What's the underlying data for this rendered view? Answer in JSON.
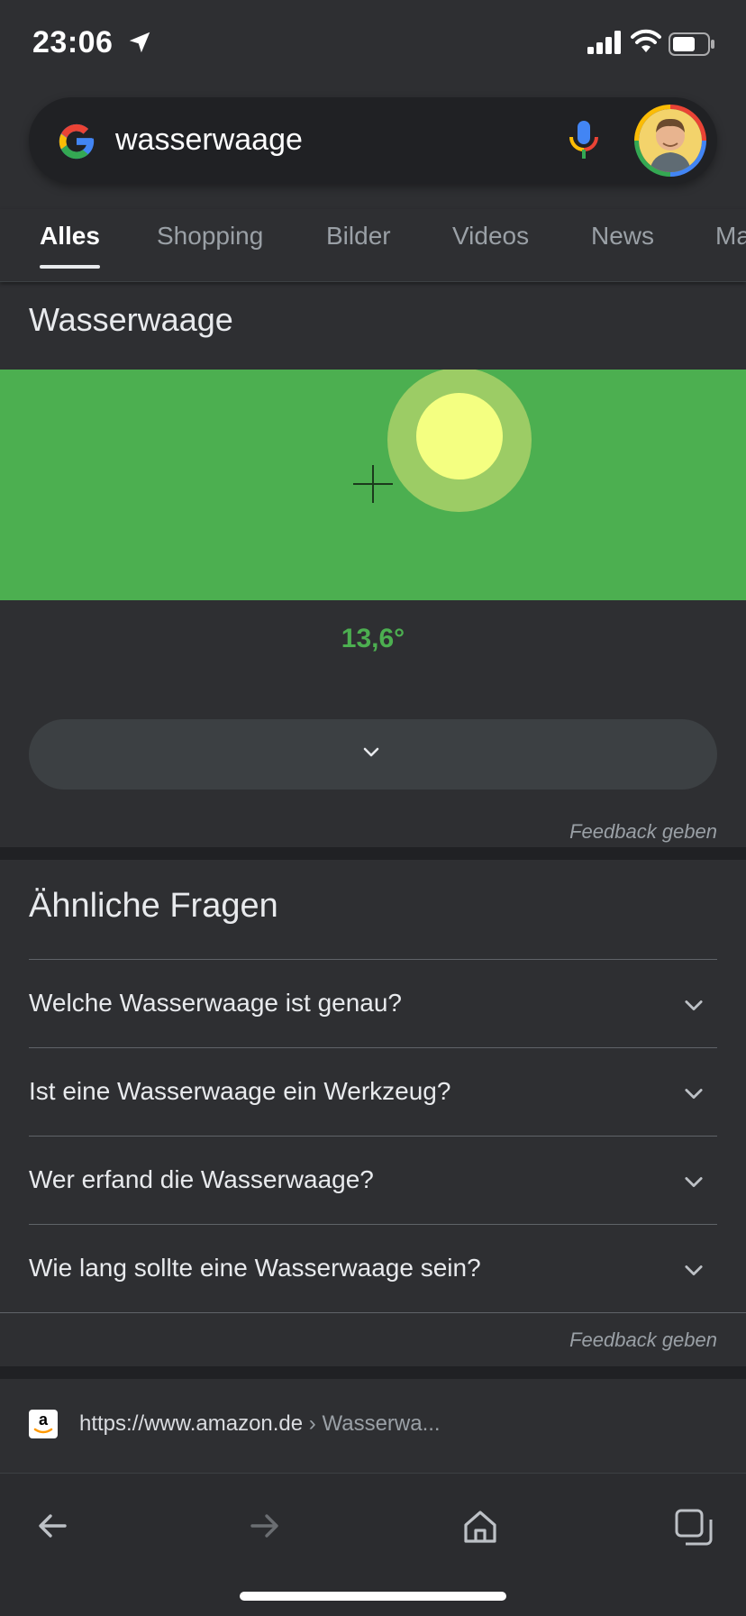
{
  "status_bar": {
    "time": "23:06",
    "icons": [
      "location-arrow-icon",
      "signal-icon",
      "wifi-icon",
      "battery-icon"
    ]
  },
  "search": {
    "query": "wasserwaage",
    "logo_icon": "google-g-icon",
    "mic_icon": "microphone-icon",
    "avatar_icon": "profile-avatar"
  },
  "tabs": [
    {
      "label": "Alles",
      "active": true
    },
    {
      "label": "Shopping",
      "active": false
    },
    {
      "label": "Bilder",
      "active": false
    },
    {
      "label": "Videos",
      "active": false
    },
    {
      "label": "News",
      "active": false
    },
    {
      "label": "Ma",
      "active": false
    }
  ],
  "level_card": {
    "title": "Wasserwaage",
    "angle": "13,6°",
    "feedback": "Feedback geben",
    "colors": {
      "background": "#4caf50",
      "bubble_outer": "#9ccc65",
      "bubble_inner": "#f4ff81"
    }
  },
  "related_questions": {
    "title": "Ähnliche Fragen",
    "items": [
      "Welche Wasserwaage ist genau?",
      "Ist eine Wasserwaage ein Werkzeug?",
      "Wer erfand die Wasserwaage?",
      "Wie lang sollte eine Wasserwaage sein?"
    ],
    "feedback": "Feedback geben"
  },
  "result": {
    "domain": "https://www.amazon.de",
    "path": " › Wasserwa..."
  },
  "toolbar": {
    "icons": [
      "back-arrow-icon",
      "forward-arrow-icon",
      "home-icon",
      "tabs-icon"
    ]
  }
}
